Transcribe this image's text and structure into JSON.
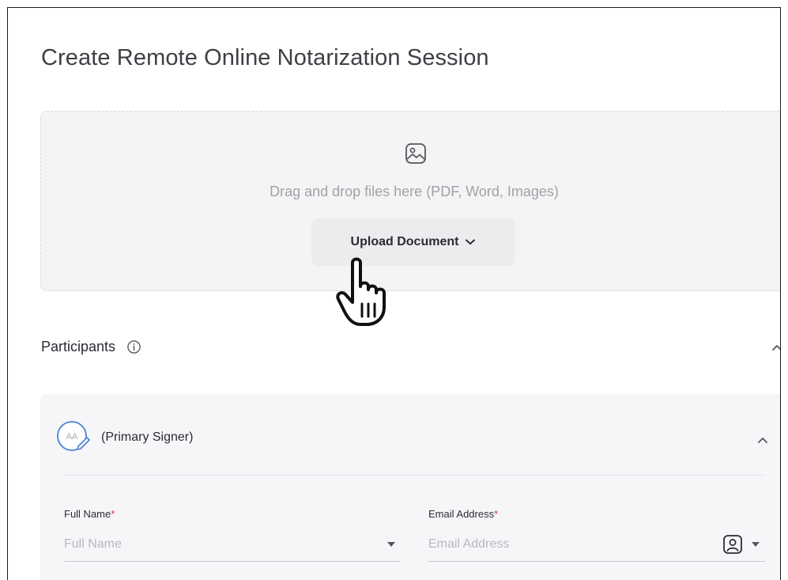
{
  "page": {
    "title": "Create Remote Online Notarization Session"
  },
  "dropzone": {
    "icon": "image-icon",
    "instruction": "Drag and drop files here (PDF, Word, Images)",
    "upload_button": "Upload Document"
  },
  "participants": {
    "title": "Participants",
    "primary_signer": {
      "avatar_initials": "AA",
      "label": "(Primary Signer)"
    },
    "fields": {
      "full_name": {
        "label": "Full Name",
        "required_mark": "*",
        "placeholder": "Full Name",
        "value": ""
      },
      "email": {
        "label": "Email Address",
        "required_mark": "*",
        "placeholder": "Email Address",
        "value": ""
      }
    }
  },
  "colors": {
    "accent_blue": "#4a7fd4",
    "required_red": "#c73b4b",
    "panel_gray": "#f4f4f5"
  }
}
